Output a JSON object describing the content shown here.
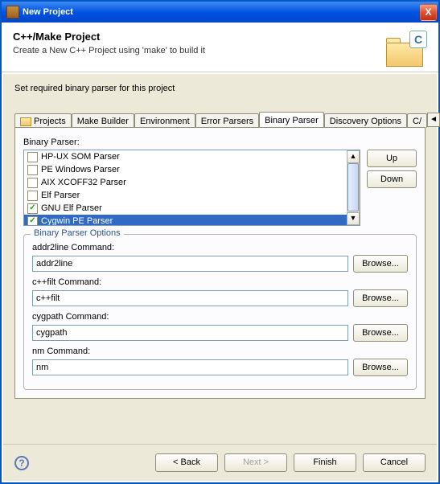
{
  "window": {
    "title": "New Project"
  },
  "header": {
    "title": "C++/Make Project",
    "subtitle": "Create a New C++ Project using 'make' to build it"
  },
  "instruction": "Set required binary parser for this project",
  "tabs": {
    "projects": "Projects",
    "make_builder": "Make Builder",
    "environment": "Environment",
    "error_parsers": "Error Parsers",
    "binary_parser": "Binary Parser",
    "discovery_options": "Discovery Options",
    "c_extra": "C/"
  },
  "parser": {
    "label": "Binary Parser:",
    "items": [
      {
        "label": "HP-UX SOM Parser",
        "checked": false
      },
      {
        "label": "PE Windows Parser",
        "checked": false
      },
      {
        "label": "AIX XCOFF32 Parser",
        "checked": false
      },
      {
        "label": "Elf Parser",
        "checked": false
      },
      {
        "label": "GNU Elf Parser",
        "checked": true
      },
      {
        "label": "Cygwin PE Parser",
        "checked": true,
        "selected": true
      }
    ],
    "up": "Up",
    "down": "Down"
  },
  "options": {
    "legend": "Binary Parser Options",
    "addr2line_label": "addr2line Command:",
    "addr2line_value": "addr2line",
    "cxxfilt_label": "c++filt Command:",
    "cxxfilt_value": "c++filt",
    "cygpath_label": "cygpath Command:",
    "cygpath_value": "cygpath",
    "nm_label": "nm Command:",
    "nm_value": "nm",
    "browse": "Browse..."
  },
  "footer": {
    "back": "< Back",
    "next": "Next >",
    "finish": "Finish",
    "cancel": "Cancel"
  }
}
